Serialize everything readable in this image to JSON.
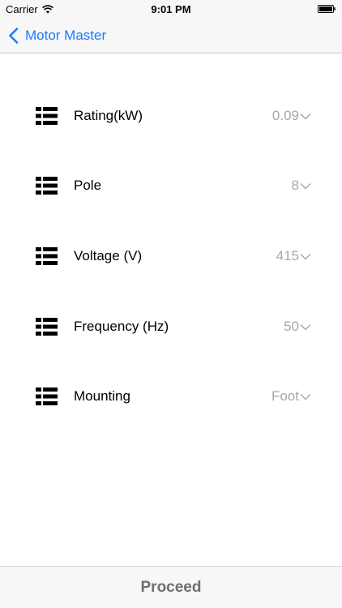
{
  "status_bar": {
    "carrier": "Carrier",
    "time": "9:01 PM"
  },
  "nav": {
    "back_label": "Motor Master"
  },
  "rows": [
    {
      "label": "Rating(kW)",
      "value": "0.09"
    },
    {
      "label": "Pole",
      "value": "8"
    },
    {
      "label": "Voltage (V)",
      "value": "415"
    },
    {
      "label": "Frequency (Hz)",
      "value": "50"
    },
    {
      "label": "Mounting",
      "value": "Foot"
    }
  ],
  "footer": {
    "proceed_label": "Proceed"
  },
  "colors": {
    "accent": "#1a7ef5",
    "value_gray": "#a8a8a8",
    "bar_bg": "#f7f7f7"
  },
  "icons": {
    "row_icon": "list-icon",
    "dropdown_icon": "chevron-down-icon",
    "back_icon": "chevron-left-icon"
  }
}
